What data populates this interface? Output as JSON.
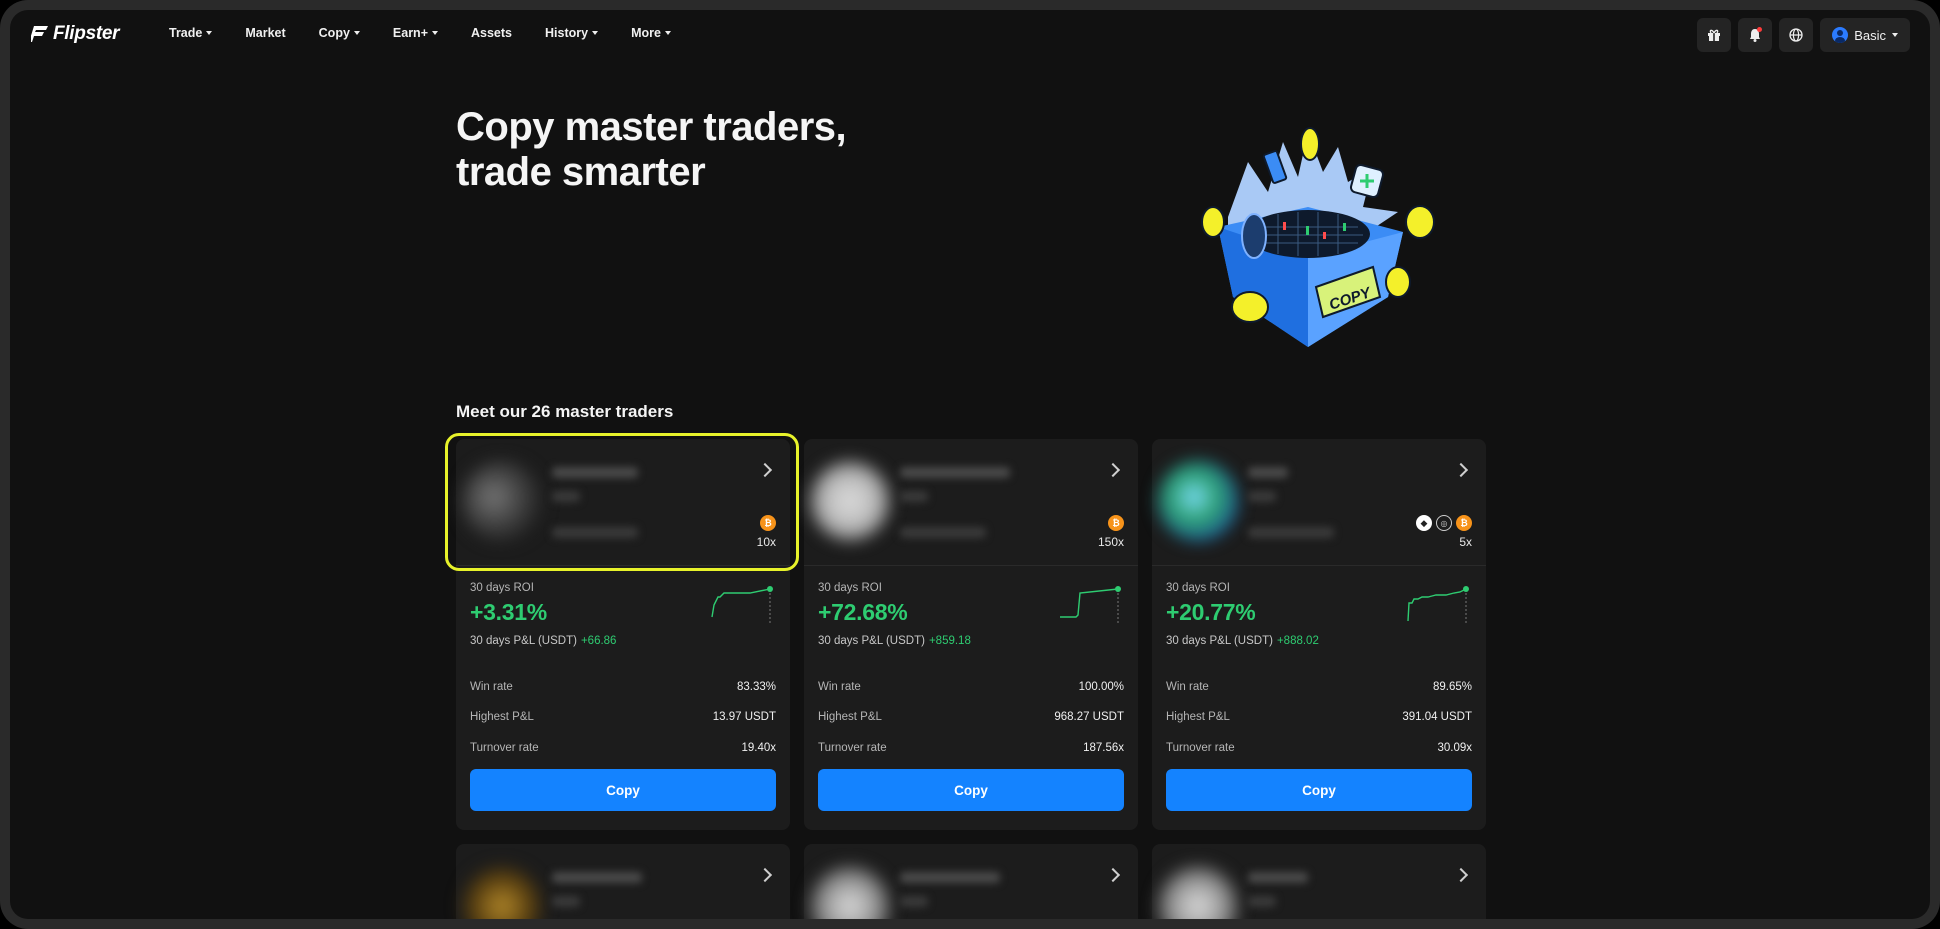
{
  "nav": {
    "brand": "Flipster",
    "menu": [
      {
        "label": "Trade",
        "dropdown": true
      },
      {
        "label": "Market",
        "dropdown": false
      },
      {
        "label": "Copy",
        "dropdown": true
      },
      {
        "label": "Earn+",
        "dropdown": true
      },
      {
        "label": "Assets",
        "dropdown": false
      },
      {
        "label": "History",
        "dropdown": true
      },
      {
        "label": "More",
        "dropdown": true
      }
    ],
    "icons": [
      "gift-icon",
      "bell-icon",
      "globe-icon"
    ],
    "account_label": "Basic"
  },
  "hero": {
    "title_line1": "Copy master traders,",
    "title_line2": "trade smarter",
    "art_text": "COPY"
  },
  "section": {
    "title": "Meet our 26 master traders"
  },
  "labels": {
    "roi": "30 days ROI",
    "pnl": "30 days P&L (USDT)",
    "win_rate": "Win rate",
    "highest_pnl": "Highest P&L",
    "turnover": "Turnover rate",
    "copy_button": "Copy"
  },
  "traders": [
    {
      "coins": [
        "btc"
      ],
      "leverage": "10x",
      "roi": "+3.31%",
      "pnl": "+66.86",
      "win_rate": "83.33%",
      "highest_pnl": "13.97 USDT",
      "turnover": "19.40x"
    },
    {
      "coins": [
        "btc"
      ],
      "leverage": "150x",
      "roi": "+72.68%",
      "pnl": "+859.18",
      "win_rate": "100.00%",
      "highest_pnl": "968.27 USDT",
      "turnover": "187.56x"
    },
    {
      "coins": [
        "eth",
        "alt",
        "btc"
      ],
      "leverage": "5x",
      "roi": "+20.77%",
      "pnl": "+888.02",
      "win_rate": "89.65%",
      "highest_pnl": "391.04 USDT",
      "turnover": "30.09x"
    }
  ],
  "colors": {
    "background": "#111111",
    "card": "#1c1c1c",
    "accent_blue": "#1483ff",
    "profit_green": "#2ecc71",
    "highlight_yellow": "#e7f22a"
  }
}
